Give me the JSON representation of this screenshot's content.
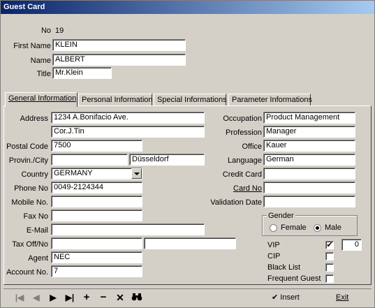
{
  "window": {
    "title": "Guest Card"
  },
  "header": {
    "no_label": "No",
    "no_value": "19",
    "first_name_label": "First Name",
    "first_name_value": "KLEIN",
    "name_label": "Name",
    "name_value": "ALBERT",
    "title_label": "Title",
    "title_value": "Mr.Klein"
  },
  "tabs": [
    {
      "label": "General Information",
      "active": true
    },
    {
      "label": "Personal Information"
    },
    {
      "label": "Special Informations"
    },
    {
      "label": "Parameter Informations"
    }
  ],
  "left": {
    "address_label": "Address",
    "address1": "1234 A.Bonifacio Ave.",
    "address2": "Cor.J.Tin",
    "postal_label": "Postal Code",
    "postal_value": "7500",
    "provin_label": "Provin./City",
    "provin_value": "",
    "city_value": "Düsseldorf",
    "country_label": "Country",
    "country_value": "GERMANY",
    "phone_label": "Phone No",
    "phone_value": "0049-2124344",
    "mobile_label": "Mobile No.",
    "mobile_value": "",
    "fax_label": "Fax No",
    "fax_value": "",
    "email_label": "E-Mail",
    "email_value": "",
    "tax_label": "Tax Off/No",
    "tax_off_value": "",
    "tax_no_value": "",
    "agent_label": "Agent",
    "agent_value": "NEC",
    "account_label": "Account No.",
    "account_value": "7"
  },
  "right": {
    "occupation_label": "Occupation",
    "occupation_value": "Product Management",
    "profession_label": "Profession",
    "profession_value": "Manager",
    "office_label": "Office",
    "office_value": "Kauer",
    "language_label": "Language",
    "language_value": "German",
    "credit_label": "Credit Card",
    "credit_value": "",
    "card_label": "Card No",
    "card_value": "",
    "validation_label": "Validation Date",
    "validation_value": "",
    "gender_title": "Gender",
    "female_label": "Female",
    "male_label": "Male",
    "gender_selected": "Male",
    "vip_label": "VIP",
    "vip_checked": true,
    "vip_value": "0",
    "cip_label": "CIP",
    "blacklist_label": "Black List",
    "frequent_label": "Frequent Guest"
  },
  "toolbar": {
    "insert_label": "Insert",
    "exit_label": "Exit",
    "icons": [
      "first-icon",
      "prev-icon",
      "next-icon",
      "last-icon",
      "add-icon",
      "remove-icon",
      "cancel-icon",
      "search-icon"
    ]
  }
}
